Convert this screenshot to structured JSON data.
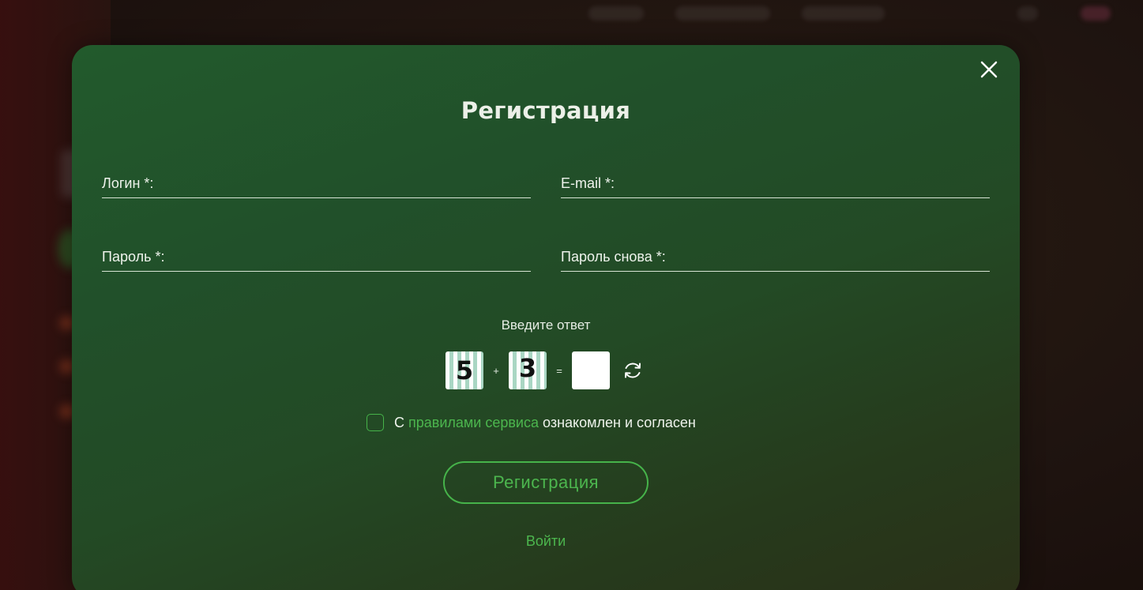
{
  "modal": {
    "title": "Регистрация",
    "fields": {
      "login_label": "Логин *:",
      "email_label": "E-mail *:",
      "password_label": "Пароль *:",
      "password_repeat_label": "Пароль снова *:"
    },
    "captcha": {
      "caption": "Введите ответ",
      "first": "5",
      "operator": "+",
      "second": "3",
      "equals": "=",
      "answer": ""
    },
    "agreement": {
      "prefix": "С",
      "link_text": "правилами сервиса",
      "suffix": "ознакомлен и согласен",
      "checked": false
    },
    "submit_label": "Регистрация",
    "login_link_label": "Войти"
  },
  "colors": {
    "accent": "#46b34a",
    "modal_top": "#225a2c",
    "modal_bottom": "#2a3018"
  },
  "icons": {
    "close": "close-icon",
    "refresh": "refresh-icon"
  }
}
